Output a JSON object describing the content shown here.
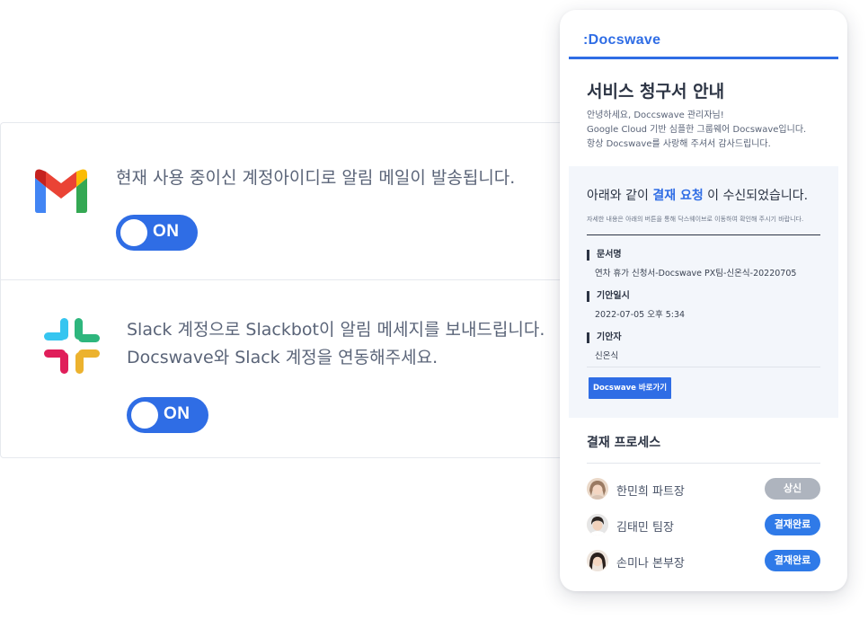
{
  "gmail_card": {
    "description": "현재 사용 중이신 계정아이디로 알림 메일이 발송됩니다.",
    "toggle_label": "ON"
  },
  "slack_card": {
    "description_line1": "Slack 계정으로 Slackbot이 알림 메세지를 보내드립니다.",
    "description_line2": "Docswave와 Slack 계정을 연동해주세요.",
    "toggle_label": "ON"
  },
  "email_preview": {
    "brand": ":Docswave",
    "title": "서비스 청구서 안내",
    "intro_lines": [
      "안녕하세요, Doccswave 관리자님!",
      "Google Cloud 기반 심플한 그룹웨어 Docswave입니다.",
      "항상 Docswave를 사랑해 주셔서 감사드립니다."
    ],
    "notice": {
      "heading_prefix": "아래와 같이 ",
      "heading_highlight": "결재 요청",
      "heading_suffix": " 이 수신되었습니다.",
      "subtext": "자세한 내용은 아래의 버튼을 통해 닥스웨이브로 이동하여 확인해 주시기 바랍니다.",
      "fields": [
        {
          "label": "문서명",
          "value": "연차 휴가 신청서-Docswave PX팀-신온식-20220705"
        },
        {
          "label": "기안일시",
          "value": "2022-07-05 오후 5:34"
        },
        {
          "label": "기안자",
          "value": "신온식"
        }
      ],
      "button_label": "Docswave 바로가기"
    },
    "process": {
      "title": "결재 프로세스",
      "approvers": [
        {
          "name": "한민희 파트장",
          "status": "상신"
        },
        {
          "name": "김태민 팀장",
          "status": "결재완료"
        },
        {
          "name": "손미나 본부장",
          "status": "결재완료"
        }
      ]
    }
  },
  "colors": {
    "accent": "#2f6de5",
    "status_done": "#2f7ae8",
    "status_submitted": "#aeb4be"
  },
  "icons": [
    "gmail-logo",
    "slack-logo",
    "avatar"
  ]
}
